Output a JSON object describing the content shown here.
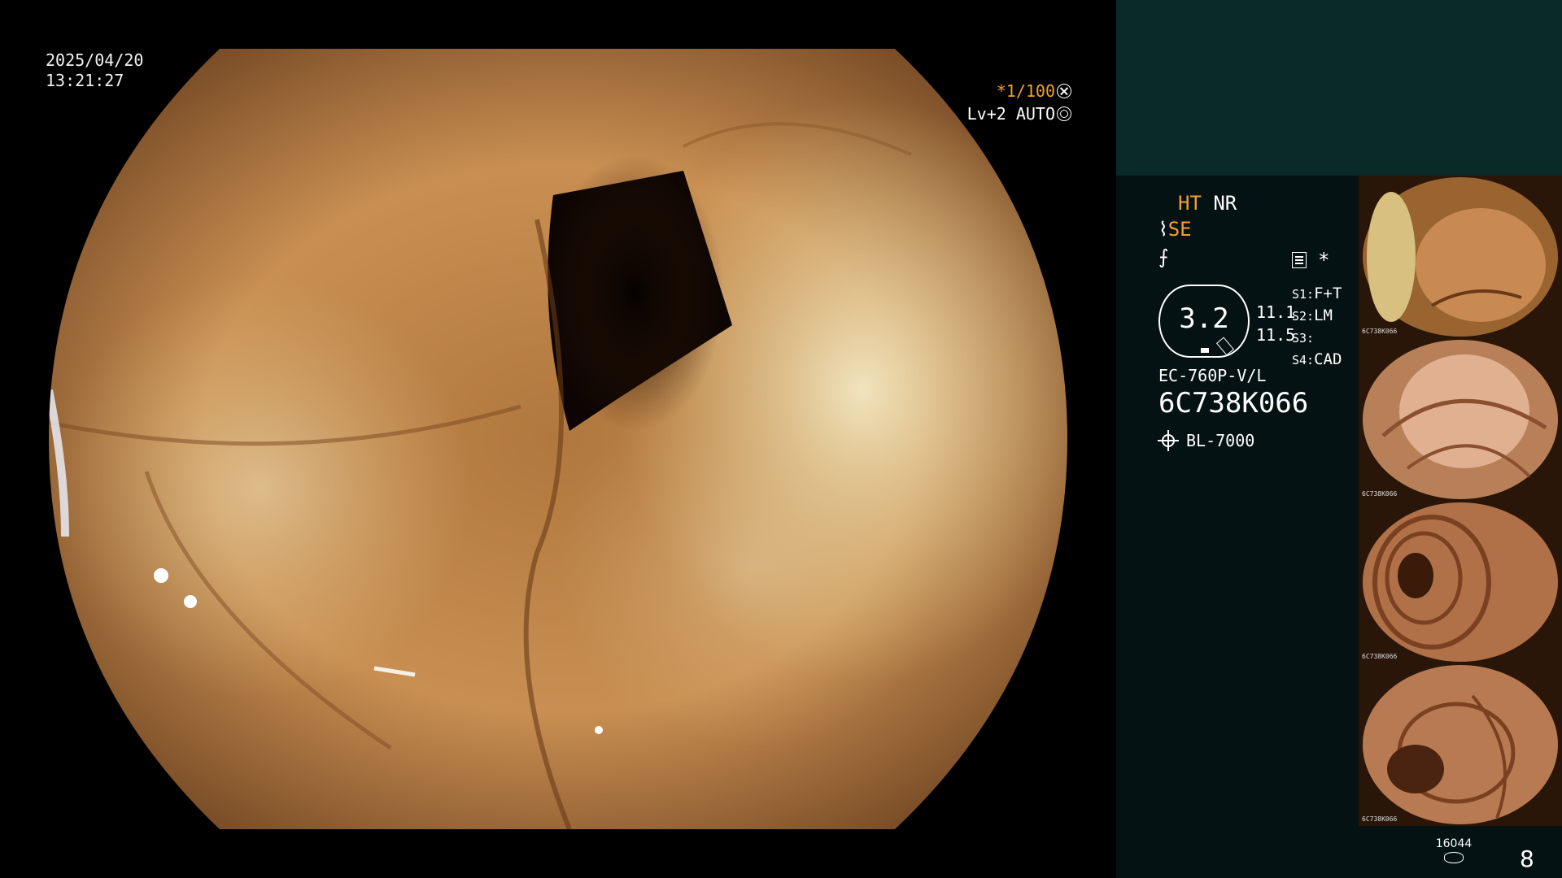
{
  "datetime": {
    "date": "2025/04/20",
    "time": "13:21:27"
  },
  "exposure": {
    "shutter": "*1/100",
    "shutter_icon": "aperture-icon",
    "level": "Lv+2 AUTO",
    "level_icon": "ring-icon"
  },
  "modes": {
    "ht": "HT",
    "nr": "NR",
    "se": "SE",
    "se_glyph": "⌇",
    "f_glyph": "⨍",
    "star": "*"
  },
  "gauge": {
    "value": "3.2"
  },
  "values": [
    "11.1",
    "11.5"
  ],
  "settings": [
    {
      "key": "S1:",
      "val": "F+T"
    },
    {
      "key": "S2:",
      "val": "LM"
    },
    {
      "key": "S3:",
      "val": ""
    },
    {
      "key": "S4:",
      "val": "CAD"
    }
  ],
  "scope": {
    "model": "EC-760P-V/L",
    "serial": "6C738K066"
  },
  "light_source": {
    "label": "BL-7000"
  },
  "thumbnails": [
    {
      "serial": "6C738K066"
    },
    {
      "serial": "6C738K066"
    },
    {
      "serial": "6C738K066"
    },
    {
      "serial": "6C738K066"
    }
  ],
  "storage": {
    "remaining": "16044"
  },
  "image_count": "8",
  "colors": {
    "accent": "#f0a030",
    "panel_top": "#0a2a2a",
    "panel": "#051214"
  }
}
